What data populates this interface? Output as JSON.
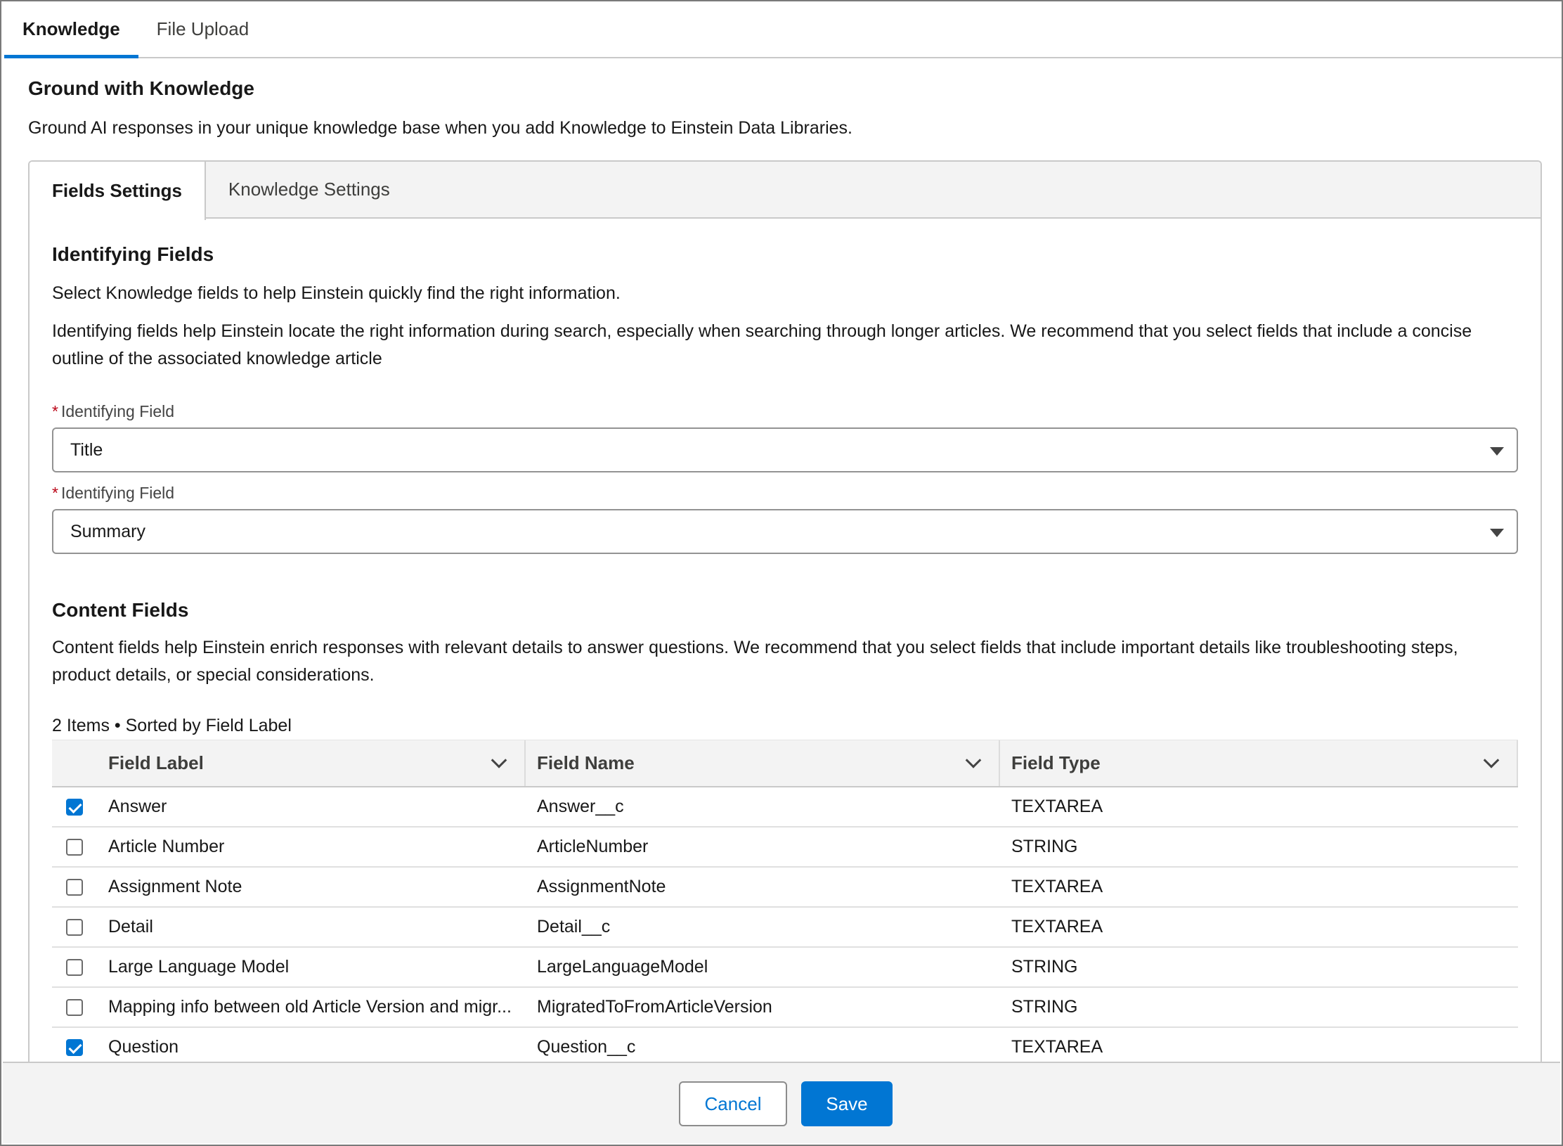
{
  "top_tabs": [
    {
      "label": "Knowledge",
      "active": true
    },
    {
      "label": "File Upload",
      "active": false
    }
  ],
  "header": {
    "title": "Ground with Knowledge",
    "description": "Ground AI responses in your unique knowledge base when you add Knowledge to Einstein Data Libraries."
  },
  "card_tabs": [
    {
      "label": "Fields Settings",
      "active": true
    },
    {
      "label": "Knowledge Settings",
      "active": false
    }
  ],
  "identifying": {
    "title": "Identifying Fields",
    "intro": "Select Knowledge fields to help Einstein quickly find the right information.",
    "detail": "Identifying fields help Einstein locate the right information during search, especially when searching through longer articles. We recommend that you select fields that include a concise outline of the associated knowledge article",
    "required_marker": "*",
    "fields": [
      {
        "label": "Identifying Field",
        "value": "Title"
      },
      {
        "label": "Identifying Field",
        "value": "Summary"
      }
    ]
  },
  "content": {
    "title": "Content Fields",
    "description": "Content fields help Einstein enrich responses with relevant details to answer questions. We recommend that you select fields that include important details like troubleshooting steps, product details, or special considerations.",
    "meta": "2 Items • Sorted by Field Label"
  },
  "table": {
    "columns": [
      "Field Label",
      "Field Name",
      "Field Type"
    ],
    "rows": [
      {
        "checked": true,
        "label": "Answer",
        "name": "Answer__c",
        "type": "TEXTAREA"
      },
      {
        "checked": false,
        "label": "Article Number",
        "name": "ArticleNumber",
        "type": "STRING"
      },
      {
        "checked": false,
        "label": "Assignment Note",
        "name": "AssignmentNote",
        "type": "TEXTAREA"
      },
      {
        "checked": false,
        "label": "Detail",
        "name": "Detail__c",
        "type": "TEXTAREA"
      },
      {
        "checked": false,
        "label": "Large Language Model",
        "name": "LargeLanguageModel",
        "type": "STRING"
      },
      {
        "checked": false,
        "label": "Mapping info between old Article Version and migr...",
        "name": "MigratedToFromArticleVersion",
        "type": "STRING"
      },
      {
        "checked": true,
        "label": "Question",
        "name": "Question__c",
        "type": "TEXTAREA"
      }
    ]
  },
  "footer": {
    "cancel_label": "Cancel",
    "save_label": "Save"
  },
  "colors": {
    "accent": "#0176d3",
    "required": "#ba0517"
  }
}
